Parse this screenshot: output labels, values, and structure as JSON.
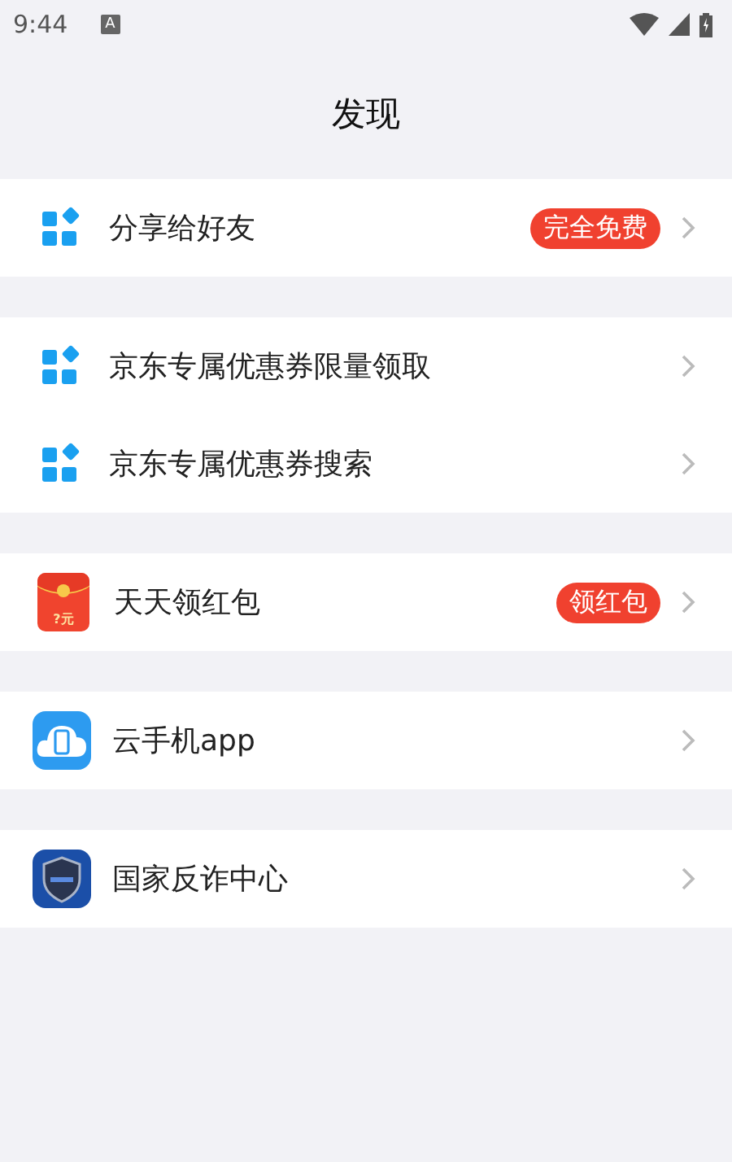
{
  "status_bar": {
    "time": "9:44",
    "notification": "A"
  },
  "title": "发现",
  "groups": [
    {
      "items": [
        {
          "kind": "grid",
          "label": "分享给好友",
          "badge": "完全免费"
        }
      ]
    },
    {
      "items": [
        {
          "kind": "grid",
          "label": "京东专属优惠券限量领取"
        },
        {
          "kind": "grid",
          "label": "京东专属优惠券搜索"
        }
      ]
    },
    {
      "items": [
        {
          "kind": "envelope",
          "icon_text": "?元",
          "label": "天天领红包",
          "badge": "领红包"
        }
      ]
    },
    {
      "items": [
        {
          "kind": "cloud",
          "label": "云手机app"
        }
      ]
    },
    {
      "items": [
        {
          "kind": "shield",
          "label": "国家反诈中心"
        }
      ]
    }
  ]
}
